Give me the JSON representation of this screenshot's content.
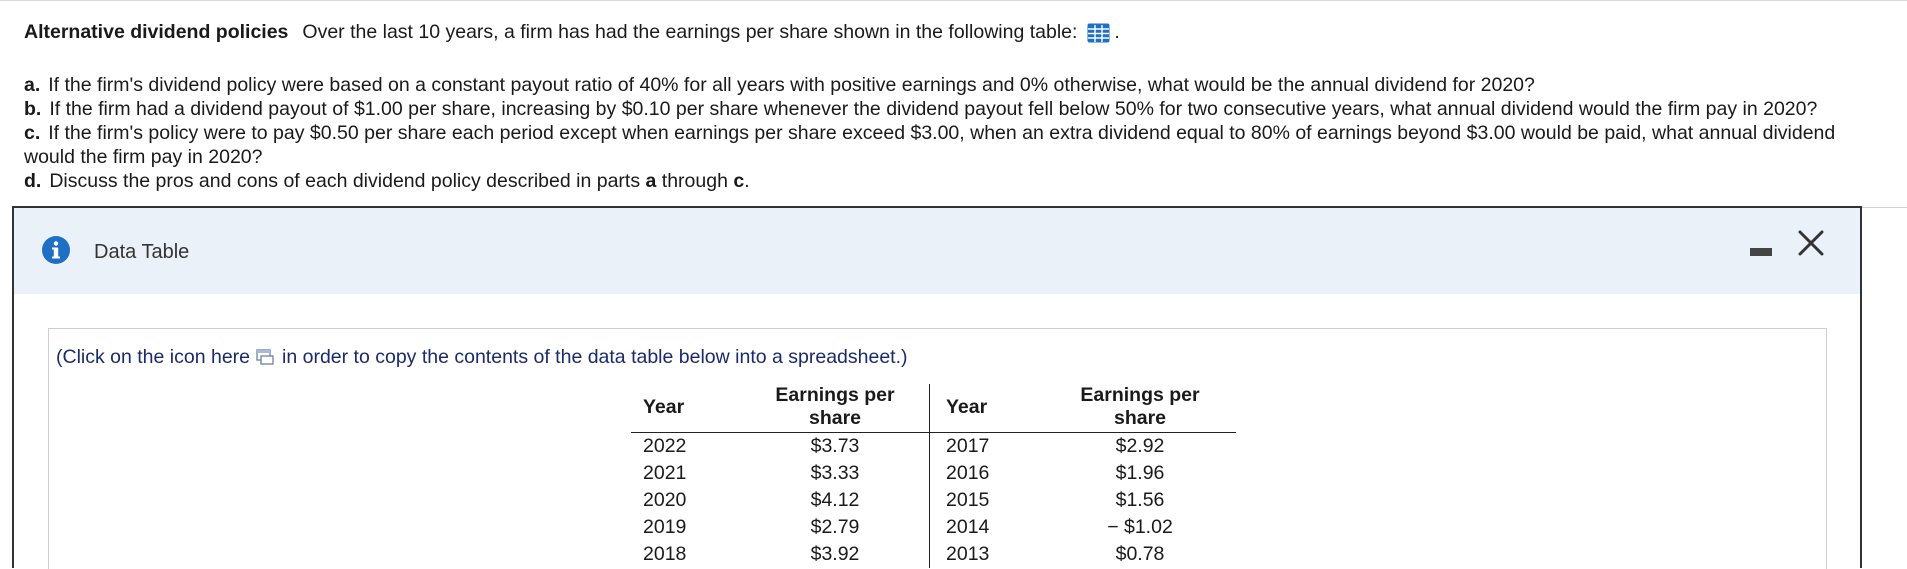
{
  "question": {
    "title": "Alternative dividend policies",
    "intro": "Over the last 10 years, a firm has had the earnings per share shown in the following table:",
    "intro_end": ".",
    "parts": [
      {
        "letter": "a.",
        "text": "If the firm's dividend policy were based on a constant payout ratio of 40% for all years with positive earnings and 0% otherwise, what would be the annual dividend for 2020?"
      },
      {
        "letter": "b.",
        "text": "If the firm had a dividend payout of $1.00 per share, increasing by $0.10 per share whenever the dividend payout fell below 50% for two consecutive years, what annual dividend would the firm pay in 2020?"
      },
      {
        "letter": "c.",
        "text": "If the firm's policy were to pay $0.50 per share each period except when earnings per share exceed $3.00, when an extra dividend equal to 80% of earnings beyond $3.00 would be paid, what annual dividend would the firm pay in 2020?"
      }
    ],
    "part_d": {
      "letter": "d.",
      "pre": "Discuss the pros and cons of each dividend policy described in parts ",
      "a": "a",
      "mid": " through ",
      "c": "c",
      "end": "."
    }
  },
  "modal": {
    "title": "Data Table",
    "copy_note_pre": "(Click on the icon here",
    "copy_note_post": "in order to copy the contents of the data table below into a spreadsheet.)",
    "columns": [
      "Year",
      "Earnings per share",
      "Year",
      "Earnings per share"
    ],
    "rows": [
      [
        "2022",
        "$3.73",
        "2017",
        "$2.92"
      ],
      [
        "2021",
        "$3.33",
        "2016",
        "$1.96"
      ],
      [
        "2020",
        "$4.12",
        "2015",
        "$1.56"
      ],
      [
        "2019",
        "$2.79",
        "2014",
        "− $1.02"
      ],
      [
        "2018",
        "$3.92",
        "2013",
        "$0.78"
      ]
    ]
  },
  "icons": {
    "table_icon": "data-table-icon",
    "info": "info-icon",
    "copy": "copy-to-spreadsheet-icon",
    "minimize": "minimize-icon",
    "close": "close-icon"
  },
  "colors": {
    "accent_blue": "#1f6fc5",
    "modal_header_bg": "#ebf1f8",
    "link_text": "#1b2a6b"
  }
}
